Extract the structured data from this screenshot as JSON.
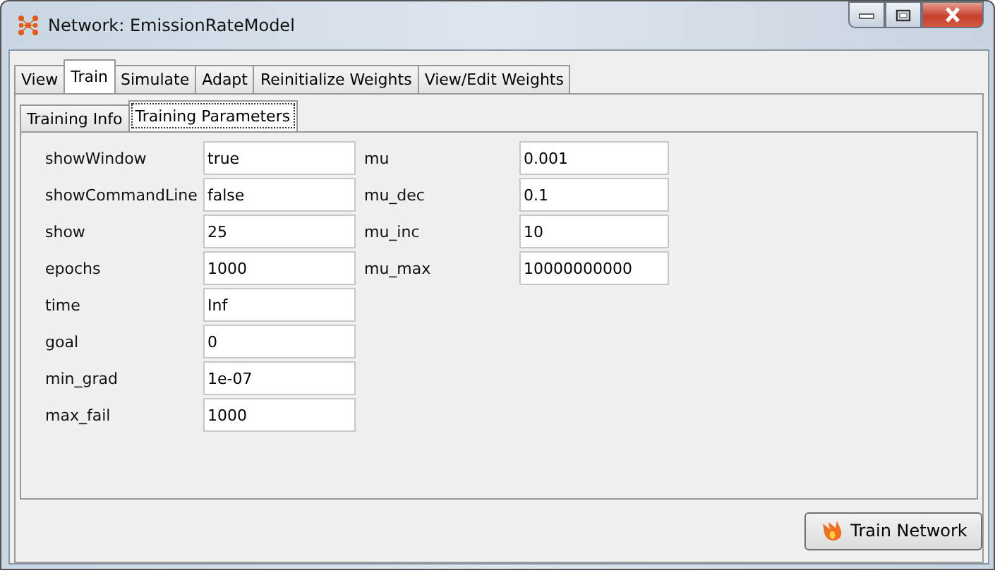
{
  "window": {
    "title": "Network: EmissionRateModel"
  },
  "tabs": [
    {
      "label": "View",
      "selected": false
    },
    {
      "label": "Train",
      "selected": true
    },
    {
      "label": "Simulate",
      "selected": false
    },
    {
      "label": "Adapt",
      "selected": false
    },
    {
      "label": "Reinitialize Weights",
      "selected": false
    },
    {
      "label": "View/Edit Weights",
      "selected": false
    }
  ],
  "subtabs": [
    {
      "label": "Training Info",
      "selected": false
    },
    {
      "label": "Training Parameters",
      "selected": true
    }
  ],
  "parameters_left": [
    {
      "label": "showWindow",
      "value": "true"
    },
    {
      "label": "showCommandLine",
      "value": "false"
    },
    {
      "label": "show",
      "value": "25"
    },
    {
      "label": "epochs",
      "value": "1000"
    },
    {
      "label": "time",
      "value": "Inf"
    },
    {
      "label": "goal",
      "value": "0"
    },
    {
      "label": "min_grad",
      "value": "1e-07"
    },
    {
      "label": "max_fail",
      "value": "1000"
    }
  ],
  "parameters_right": [
    {
      "label": "mu",
      "value": "0.001"
    },
    {
      "label": "mu_dec",
      "value": "0.1"
    },
    {
      "label": "mu_inc",
      "value": "10"
    },
    {
      "label": "mu_max",
      "value": "10000000000"
    }
  ],
  "train_button": {
    "label": "Train Network"
  }
}
